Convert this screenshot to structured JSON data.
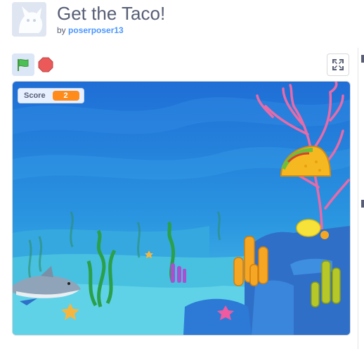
{
  "project": {
    "title": "Get the Taco!",
    "by_prefix": "by",
    "author": "poserposer13"
  },
  "controls": {
    "green_flag_icon": "green-flag-icon",
    "stop_icon": "stop-sign-icon",
    "fullscreen_icon": "fullscreen-icon"
  },
  "stage": {
    "score_label": "Score",
    "score_value": "2"
  },
  "colors": {
    "water_top": "#1f6ed6",
    "water_bottom": "#52c4e8",
    "score_accent": "#ff8c1a",
    "link": "#4c97ff"
  }
}
